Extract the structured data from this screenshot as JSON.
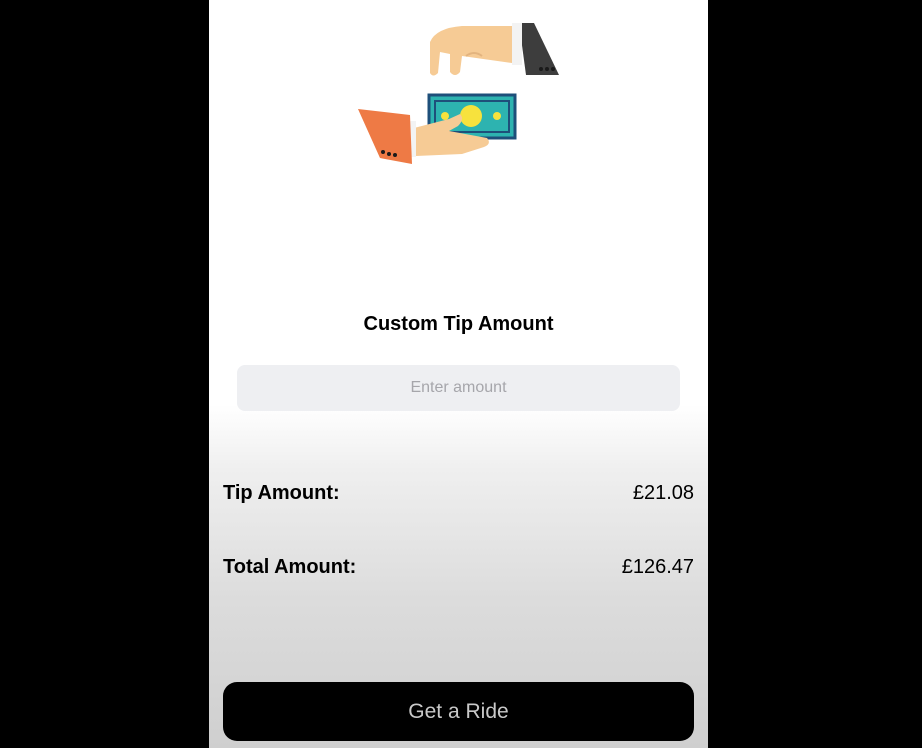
{
  "custom_tip": {
    "title": "Custom Tip Amount",
    "input_placeholder": "Enter amount",
    "input_value": ""
  },
  "summary": {
    "tip_label": "Tip Amount:",
    "tip_value": "£21.08",
    "total_label": "Total Amount:",
    "total_value": "£126.47"
  },
  "action": {
    "button_label": "Get a Ride"
  },
  "illustration": {
    "icon": "money-handover-illustration"
  },
  "colors": {
    "background_outer": "#000000",
    "screen": "#ffffff",
    "input_bg": "#eeeff2",
    "button_bg": "#000000",
    "button_text": "#c9c9c9"
  }
}
